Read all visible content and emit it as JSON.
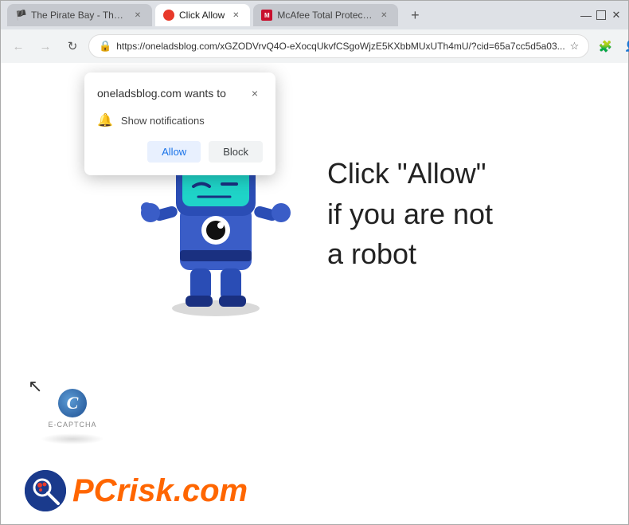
{
  "titlebar": {
    "tabs": [
      {
        "id": "tab-pirate",
        "label": "The Pirate Bay - The galaxy's m...",
        "favicon": "🏴",
        "active": false
      },
      {
        "id": "tab-clickallow",
        "label": "Click Allow",
        "active": true
      },
      {
        "id": "tab-mcafee",
        "label": "McAfee Total Protection",
        "active": false
      }
    ],
    "new_tab_label": "+",
    "window_controls": {
      "minimize": "—",
      "maximize": "□",
      "close": "✕"
    }
  },
  "navbar": {
    "back_tooltip": "Back",
    "forward_tooltip": "Forward",
    "reload_tooltip": "Reload",
    "address": "https://oneladsblog.com/xGZODVrvQ4O-eXocqUkvfCSgoWjzE5KXbbMUxUTh4mU/?cid=65a7cc5d5a03...",
    "bookmark_icon": "☆",
    "profile_icon": "👤",
    "menu_icon": "⋮"
  },
  "notification_popup": {
    "title": "oneladsblog.com wants to",
    "close_btn": "×",
    "permission_text": "Show notifications",
    "allow_label": "Allow",
    "block_label": "Block"
  },
  "page": {
    "main_text_line1": "Click \"Allow\"",
    "main_text_line2": "if you are not",
    "main_text_line3": "a robot",
    "ecaptcha_label": "E-CAPTCHA",
    "ecaptcha_letter": "C"
  },
  "pcrisk": {
    "text_gray": "PC",
    "text_orange": "risk.com"
  },
  "cursor_icon": "↖",
  "colors": {
    "allow_bg": "#e8f0fe",
    "allow_text": "#1a73e8",
    "block_bg": "#f1f3f4",
    "brand_orange": "#ff6600",
    "brand_dark": "#1a3a8c"
  }
}
